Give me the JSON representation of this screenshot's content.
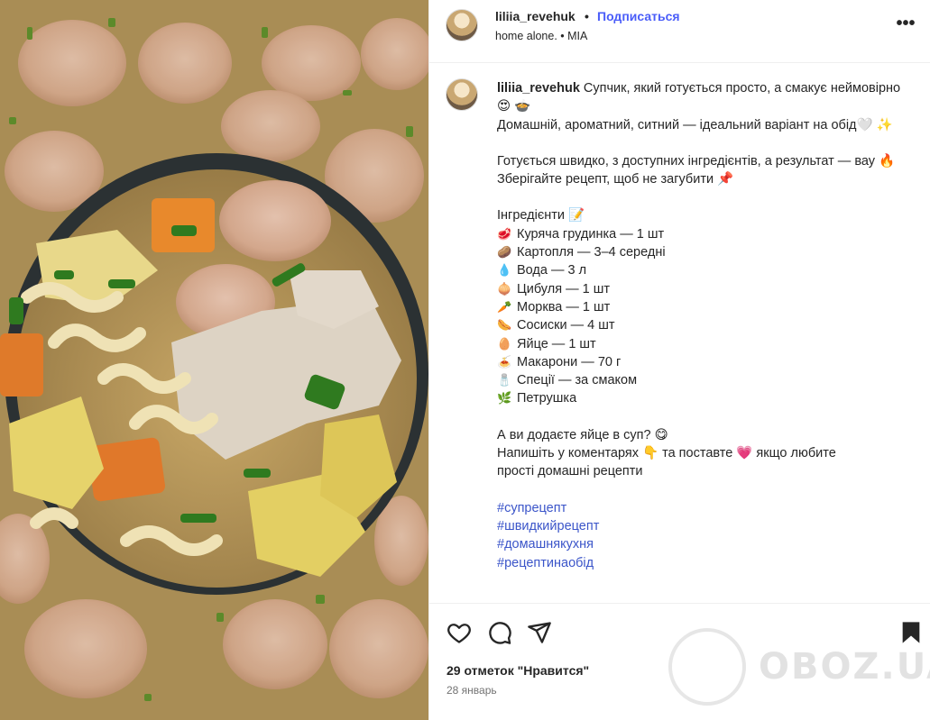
{
  "header": {
    "username": "liliia_revehuk",
    "separator": "•",
    "follow_label": "Подписаться",
    "subtitle": "home alone. • MIA",
    "more_label": "•••"
  },
  "caption": {
    "username": "liliia_revehuk",
    "intro_line1": "Супчик, який готується просто, а смакує неймовірно 😍 🍲",
    "intro_line2": "Домашній, ароматний, ситний — ідеальний варіант на обід🤍 ✨",
    "para2_line1": "Готується швидко, з доступних інгредієнтів, а результат — вау 🔥",
    "para2_line2": "Зберігайте рецепт, щоб не загубити 📌",
    "ingredients_title": "Інгредієнти 📝",
    "ingredients": [
      {
        "emoji": "🥩",
        "text": "Куряча грудинка — 1 шт"
      },
      {
        "emoji": "🥔",
        "text": "Картопля — 3–4 середні"
      },
      {
        "emoji": "💧",
        "text": "Вода — 3 л"
      },
      {
        "emoji": "🧅",
        "text": "Цибуля — 1 шт"
      },
      {
        "emoji": "🥕",
        "text": "Морква — 1 шт"
      },
      {
        "emoji": "🌭",
        "text": "Сосиски — 4 шт"
      },
      {
        "emoji": "🥚",
        "text": "Яйце — 1 шт"
      },
      {
        "emoji": "🍝",
        "text": "Макарони — 70 г"
      },
      {
        "emoji": "🧂",
        "text": "Спеції — за смаком"
      },
      {
        "emoji": "🌿",
        "text": "Петрушка"
      }
    ],
    "question": "А ви додаєте яйце в суп? 😋",
    "cta_line1": "Напишіть у коментарях 👇 та поставте 💗 якщо любите",
    "cta_line2": "прості домашні рецепти",
    "hashtags": [
      "#супрецепт",
      "#швидкийрецепт",
      "#домашнякухня",
      "#рецептинаобід"
    ]
  },
  "actions": {
    "like_icon": "heart-icon",
    "comment_icon": "comment-icon",
    "share_icon": "share-icon",
    "save_icon": "bookmark-icon",
    "likes_text": "29 отметок \"Нравится\"",
    "date_text": "28 январь"
  },
  "watermark": {
    "text": "OBOZ.UA"
  },
  "colors": {
    "link": "#4a5df9",
    "hashtag": "#3b55c9",
    "text": "#262626",
    "muted": "#737373"
  }
}
